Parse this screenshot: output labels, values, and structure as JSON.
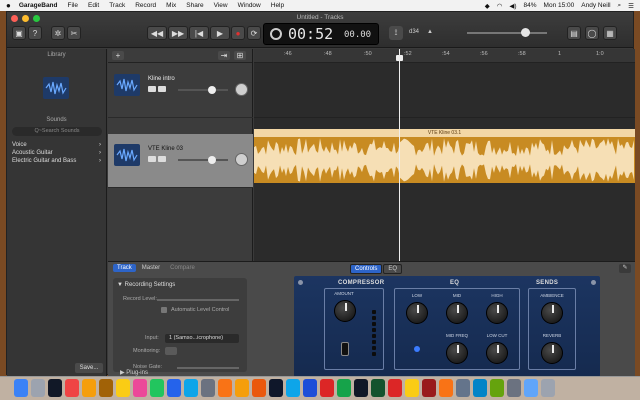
{
  "menubar": {
    "apple": "",
    "app_name": "GarageBand",
    "items": [
      "File",
      "Edit",
      "Track",
      "Record",
      "Mix",
      "Share",
      "View",
      "Window",
      "Help"
    ],
    "battery": "84%",
    "clock": "Mon 15:00",
    "user": "Andy Neill"
  },
  "window": {
    "title": "Untitled - Tracks"
  },
  "toolbar": {
    "lcd_time": "00:52",
    "lcd_frac": "00.00",
    "counter": "d34",
    "tuner_icon": "tuning-fork-icon"
  },
  "library": {
    "title": "Library",
    "sounds_label": "Sounds",
    "search_placeholder": "Q~Search Sounds",
    "items": [
      "Voice",
      "Acoustic Guitar",
      "Electric Guitar and Bass"
    ],
    "save_button": "Save..."
  },
  "tracks": [
    {
      "name": "Kline intro",
      "selected": false
    },
    {
      "name": "VTE Kline 03",
      "selected": true
    }
  ],
  "ruler": {
    "ticks": [
      ":46",
      ":48",
      ":50",
      ":52",
      ":54",
      ":56",
      ":58",
      "1",
      "1:0"
    ]
  },
  "region": {
    "label": "VTE Kline 03.1"
  },
  "editor": {
    "tab_track": "Track",
    "tab_master": "Master",
    "tab_compare": "Compare",
    "rec_title": "Recording Settings",
    "record_level": "Record Level:",
    "auto_level": "Automatic Level Control",
    "input_label": "Input:",
    "input_value": "1 (Samso...icrophone)",
    "monitoring": "Monitoring:",
    "noise_gate": "Noise Gate:",
    "plugins": "Plug-ins",
    "controls_tab": "Controls",
    "eq_tab": "EQ"
  },
  "amp": {
    "compressor_title": "COMPRESSOR",
    "eq_title": "EQ",
    "sends_title": "SENDS",
    "amount": "AMOUNT",
    "low": "LOW",
    "mid": "MID",
    "high": "HIGH",
    "mid_freq": "MID FREQ",
    "low_cut": "LOW CUT",
    "ambience": "AMBIENCE",
    "reverb": "REVERB"
  },
  "colors": {
    "region_body": "#c88b22",
    "region_header": "#f3d7a6",
    "accent_blue": "#2d64c8",
    "amp_panel": "#1c3561"
  },
  "dock": {
    "app_icons": [
      "finder-icon",
      "launchpad-icon",
      "clock-icon",
      "calendar-icon",
      "photos-icon",
      "contacts-icon",
      "notes-icon",
      "music-icon",
      "chart-icon",
      "keynote-icon",
      "appstore-icon",
      "settings-icon",
      "chrome-icon",
      "garageband-icon",
      "firefox-icon",
      "quicktime-icon",
      "safari-icon",
      "word-icon",
      "powerpoint-icon",
      "excel-icon",
      "terminal-icon",
      "audition-icon",
      "record-icon",
      "radiation-icon",
      "shield-icon",
      "vlc-icon",
      "image-icon",
      "skype-icon",
      "gif-icon",
      "gear-icon",
      "folder-icon",
      "trash-icon"
    ]
  }
}
